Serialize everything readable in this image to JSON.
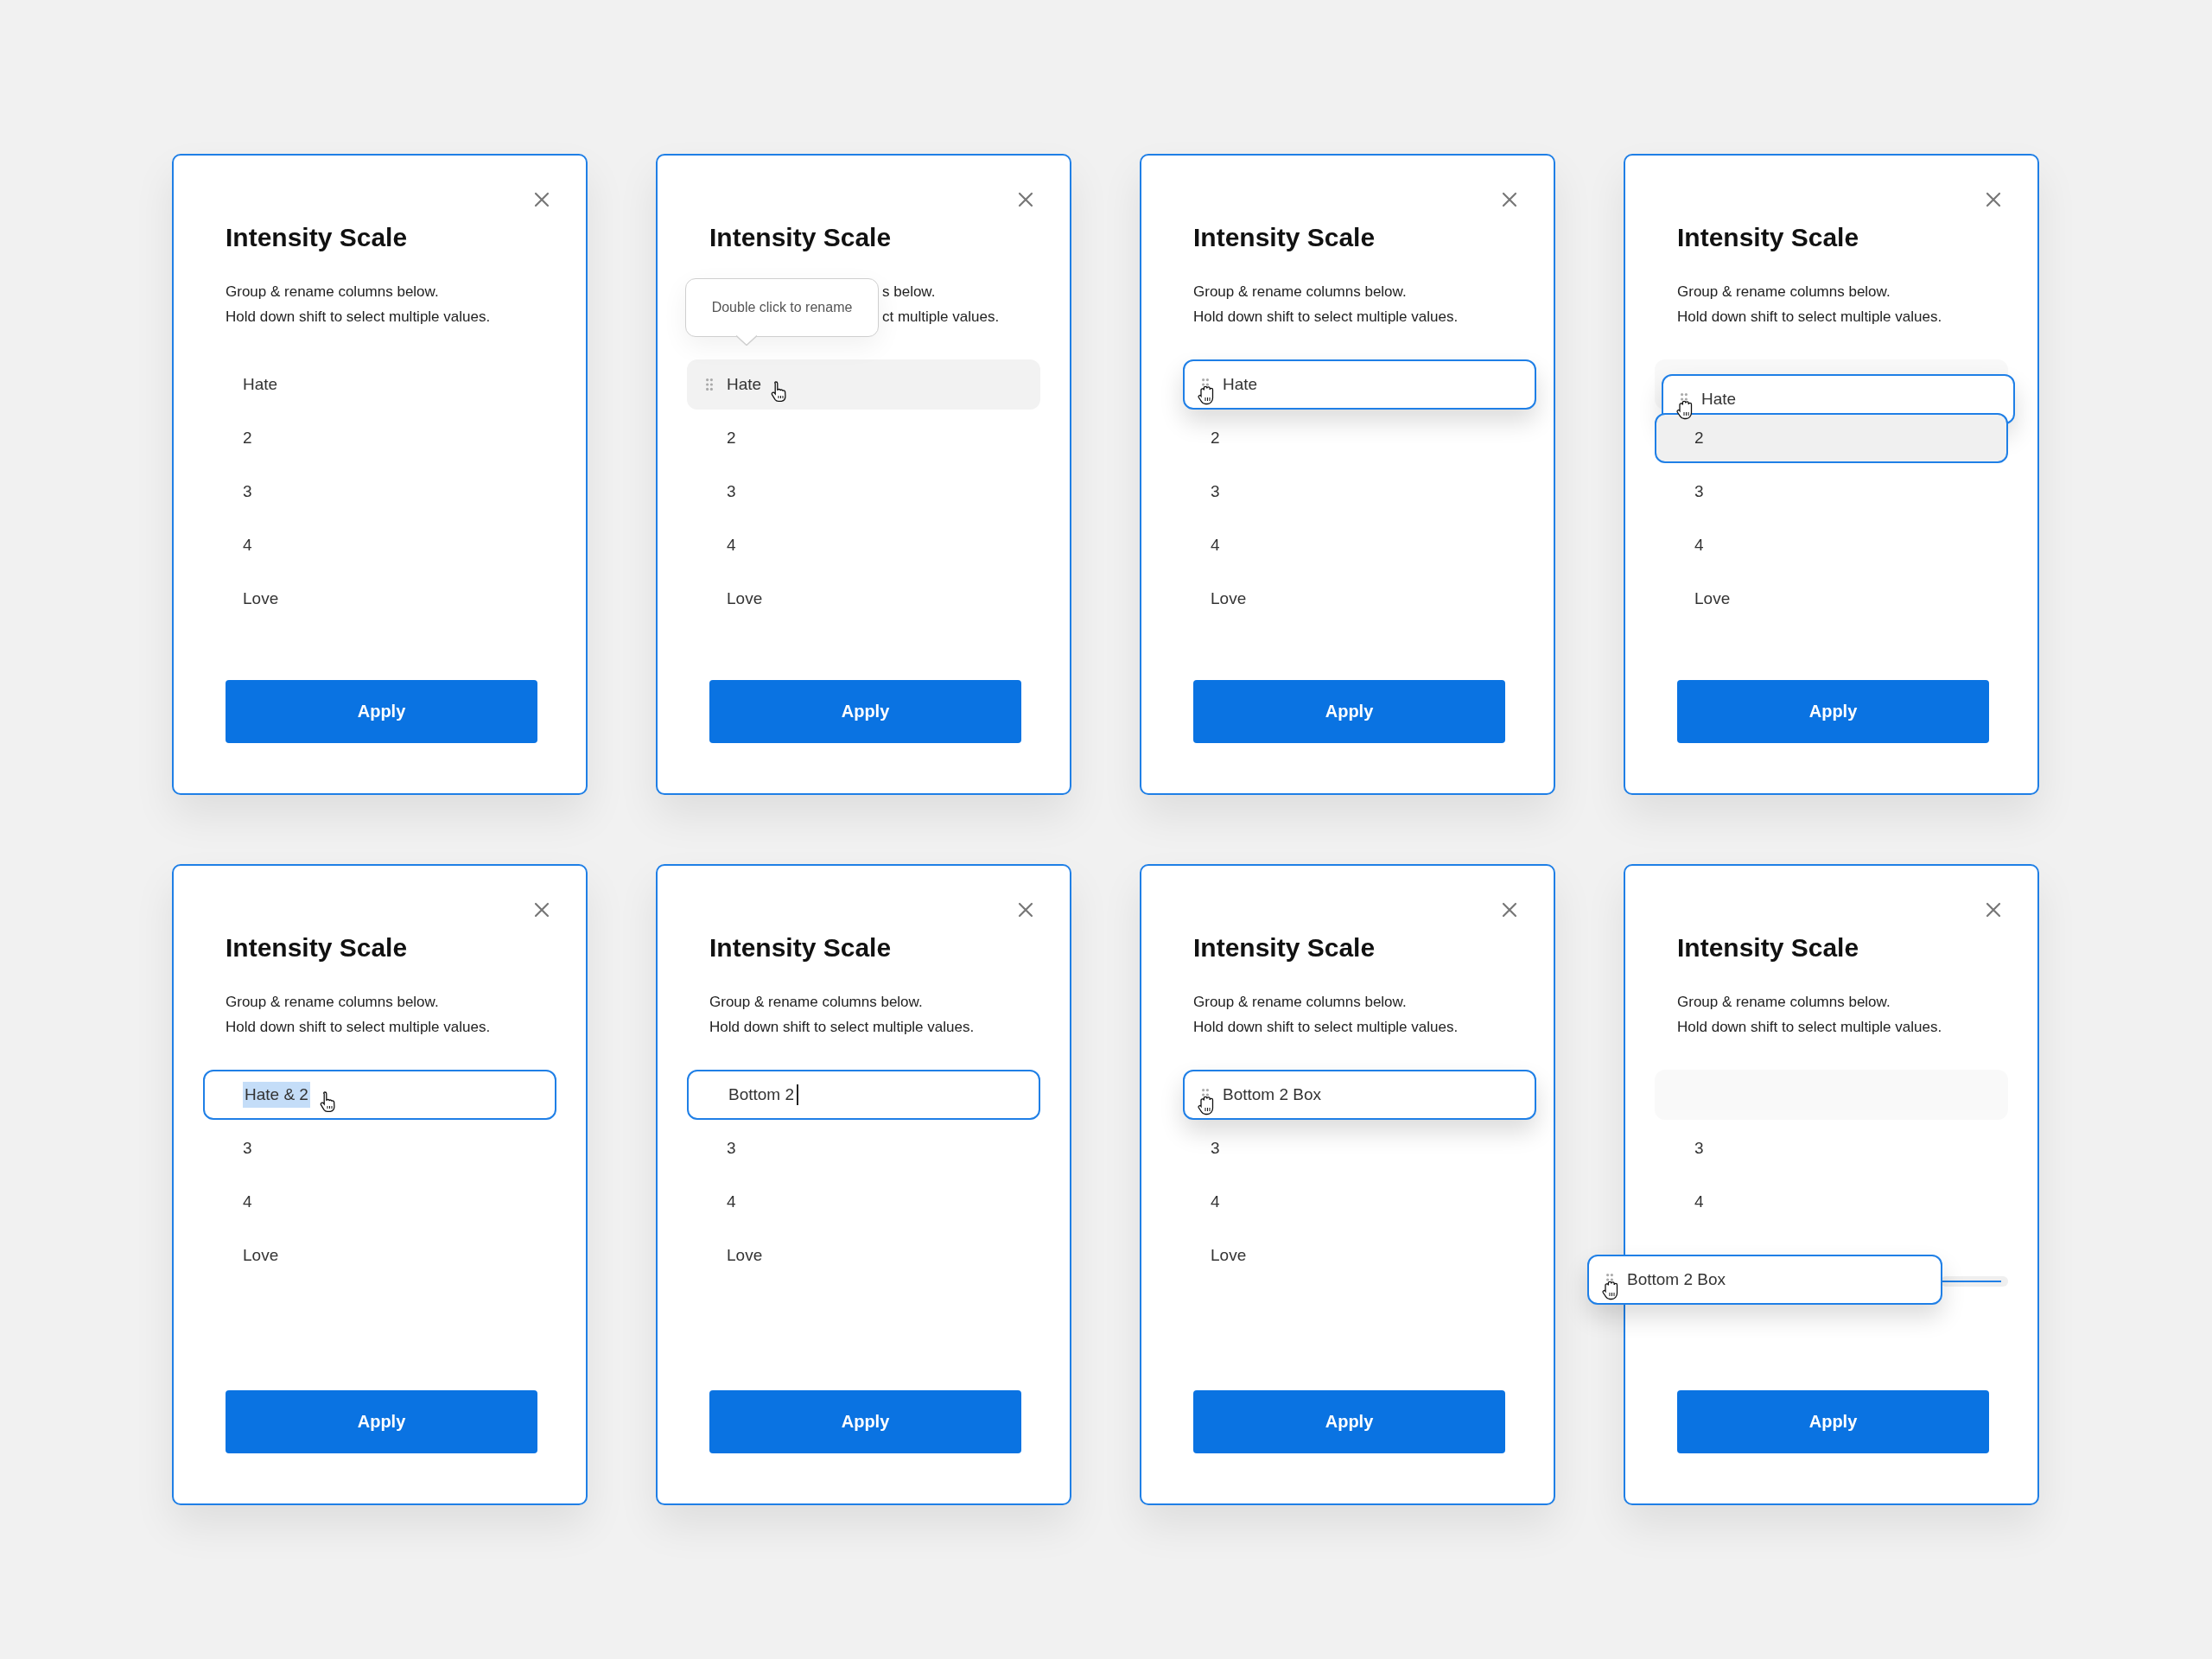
{
  "panels": [
    {
      "title": "Intensity Scale",
      "description": [
        "Group & rename columns below.",
        "Hold down shift to select multiple values."
      ],
      "items": [
        {
          "label": "Hate",
          "kind": "plain"
        },
        {
          "label": "2",
          "kind": "plain"
        },
        {
          "label": "3",
          "kind": "plain"
        },
        {
          "label": "4",
          "kind": "plain"
        },
        {
          "label": "Love",
          "kind": "plain"
        }
      ],
      "button": "Apply"
    },
    {
      "title": "Intensity Scale",
      "description": [
        "s below.",
        "ct multiple values."
      ],
      "tooltip": "Double click to rename",
      "items": [
        {
          "label": "Hate",
          "kind": "hover",
          "cursor": {
            "kind": "pointer"
          }
        },
        {
          "label": "2",
          "kind": "plain"
        },
        {
          "label": "3",
          "kind": "plain"
        },
        {
          "label": "4",
          "kind": "plain"
        },
        {
          "label": "Love",
          "kind": "plain"
        }
      ],
      "button": "Apply"
    },
    {
      "title": "Intensity Scale",
      "description": [
        "Group & rename columns below.",
        "Hold down shift to select multiple values."
      ],
      "items": [
        {
          "label": "Hate",
          "kind": "raised",
          "cursor": {
            "kind": "grab"
          }
        },
        {
          "label": "2",
          "kind": "plain"
        },
        {
          "label": "3",
          "kind": "plain"
        },
        {
          "label": "4",
          "kind": "plain"
        },
        {
          "label": "Love",
          "kind": "plain"
        }
      ],
      "button": "Apply"
    },
    {
      "title": "Intensity Scale",
      "description": [
        "Group & rename columns below.",
        "Hold down shift to select multiple values."
      ],
      "items": [
        {
          "label": "Hate",
          "kind": "lifted",
          "cursor": {
            "kind": "grab"
          }
        },
        {
          "label": "2",
          "kind": "drop-target"
        },
        {
          "label": "3",
          "kind": "plain"
        },
        {
          "label": "4",
          "kind": "plain"
        },
        {
          "label": "Love",
          "kind": "plain"
        }
      ],
      "button": "Apply"
    },
    {
      "title": "Intensity Scale",
      "description": [
        "Group & rename columns below.",
        "Hold down shift to select multiple values."
      ],
      "items": [
        {
          "label": "Hate & 2",
          "kind": "editing",
          "text_selected": true,
          "cursor": {
            "kind": "pointer"
          }
        },
        {
          "label": "3",
          "kind": "plain"
        },
        {
          "label": "4",
          "kind": "plain"
        },
        {
          "label": "Love",
          "kind": "plain"
        }
      ],
      "button": "Apply"
    },
    {
      "title": "Intensity Scale",
      "description": [
        "Group & rename columns below.",
        "Hold down shift to select multiple values."
      ],
      "items": [
        {
          "label": "Bottom 2",
          "kind": "editing",
          "text_selected": false
        },
        {
          "label": "3",
          "kind": "plain"
        },
        {
          "label": "4",
          "kind": "plain"
        },
        {
          "label": "Love",
          "kind": "plain"
        }
      ],
      "button": "Apply"
    },
    {
      "title": "Intensity Scale",
      "description": [
        "Group & rename columns below.",
        "Hold down shift to select multiple values."
      ],
      "items": [
        {
          "label": "Bottom 2 Box",
          "kind": "raised",
          "cursor": {
            "kind": "grab"
          }
        },
        {
          "label": "3",
          "kind": "plain"
        },
        {
          "label": "4",
          "kind": "plain"
        },
        {
          "label": "Love",
          "kind": "plain"
        }
      ],
      "button": "Apply"
    },
    {
      "title": "Intensity Scale",
      "description": [
        "Group & rename columns below.",
        "Hold down shift to select multiple values."
      ],
      "items": [
        {
          "kind": "placeholder"
        },
        {
          "label": "3",
          "kind": "plain"
        },
        {
          "label": "4",
          "kind": "plain"
        }
      ],
      "drag_card": {
        "label": "Bottom 2 Box",
        "cursor": {
          "kind": "grab"
        }
      },
      "button": "Apply"
    }
  ]
}
